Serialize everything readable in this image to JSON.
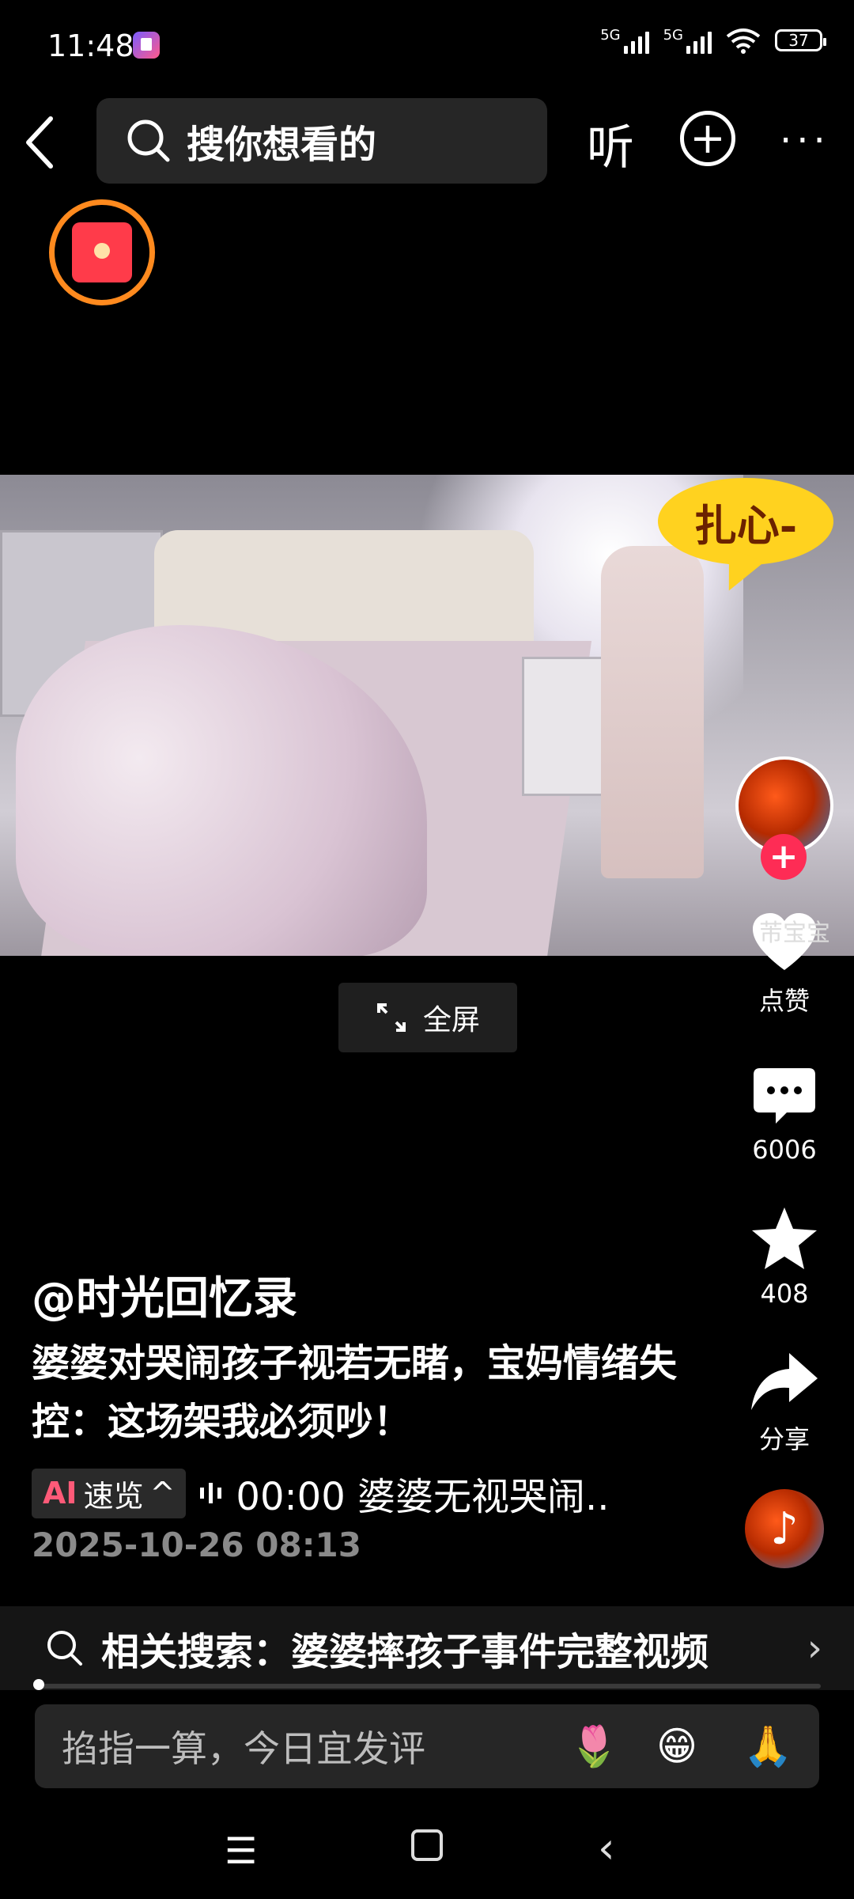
{
  "status_bar": {
    "time": "11:48",
    "network_1": "5G",
    "network_2": "5G",
    "battery": "37"
  },
  "top_bar": {
    "search_placeholder": "搜你想看的",
    "listen_label": "听",
    "more_label": "···"
  },
  "video": {
    "speech_text": "扎心-",
    "fullscreen_label": "全屏"
  },
  "right_rail": {
    "author_name": "芾宝宝",
    "like_label": "点赞",
    "comment_count": "6006",
    "favorite_count": "408",
    "share_label": "分享"
  },
  "caption": {
    "author": "@时光回忆录",
    "description": "婆婆对哭闹孩子视若无睹，宝妈情绪失控：这场架我必须吵！",
    "ai_badge_ai": "AI",
    "ai_badge_label": "速览",
    "ai_summary": "00:00 婆婆无视哭闹..",
    "timestamp": "2025-10-26 08:13"
  },
  "related_search": {
    "text": "相关搜索：婆婆摔孩子事件完整视频"
  },
  "comment_input": {
    "placeholder": "掐指一算，今日宜发评",
    "emojis": [
      "🌷",
      "😁",
      "🙏"
    ]
  },
  "colors": {
    "accent": "#fe2c55",
    "envelope_ring": "#ff8a1e",
    "ai_pink": "#ff5a78"
  }
}
